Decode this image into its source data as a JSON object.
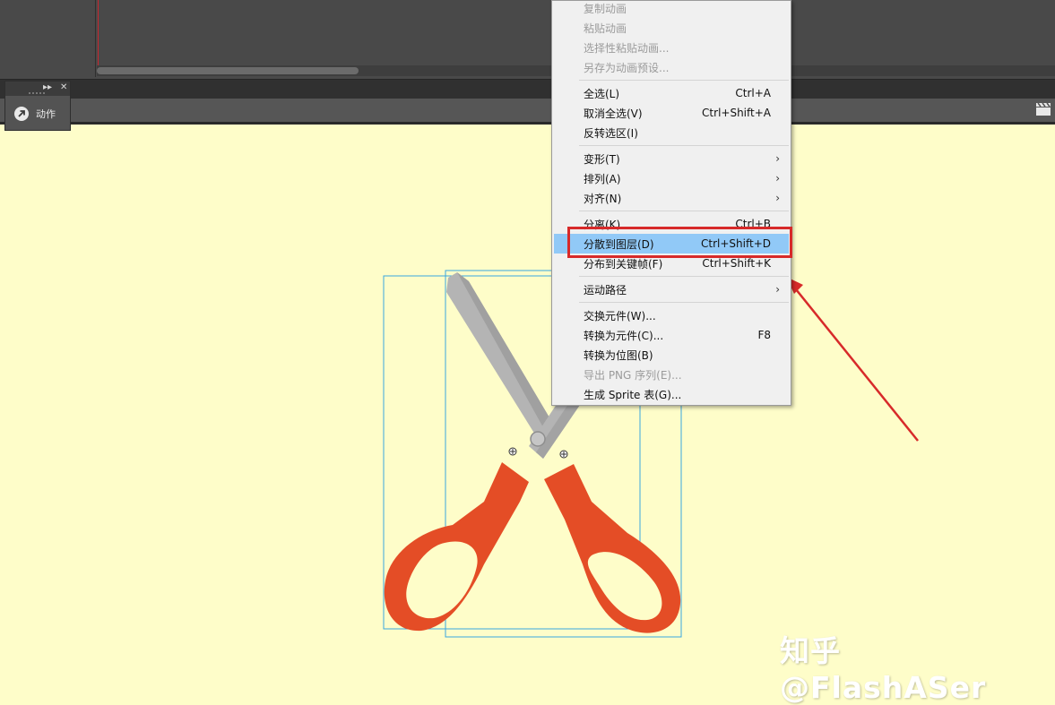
{
  "actions_panel": {
    "label": "动作",
    "expand_glyph": "▸▸",
    "close_glyph": "✕"
  },
  "context_menu": {
    "items": [
      {
        "label": "复制动画",
        "shortcut": "",
        "disabled": true
      },
      {
        "label": "粘贴动画",
        "shortcut": "",
        "disabled": true
      },
      {
        "label": "选择性粘贴动画...",
        "shortcut": "",
        "disabled": true
      },
      {
        "label": "另存为动画预设...",
        "shortcut": "",
        "disabled": true
      },
      {
        "label": "全选(L)",
        "shortcut": "Ctrl+A",
        "disabled": false
      },
      {
        "label": "取消全选(V)",
        "shortcut": "Ctrl+Shift+A",
        "disabled": false
      },
      {
        "label": "反转选区(I)",
        "shortcut": "",
        "disabled": false
      },
      {
        "label": "变形(T)",
        "shortcut": "",
        "disabled": false,
        "submenu": true
      },
      {
        "label": "排列(A)",
        "shortcut": "",
        "disabled": false,
        "submenu": true
      },
      {
        "label": "对齐(N)",
        "shortcut": "",
        "disabled": false,
        "submenu": true
      },
      {
        "label": "分离(K)",
        "shortcut": "Ctrl+B",
        "disabled": false
      },
      {
        "label": "分散到图层(D)",
        "shortcut": "Ctrl+Shift+D",
        "disabled": false,
        "highlighted": true
      },
      {
        "label": "分布到关键帧(F)",
        "shortcut": "Ctrl+Shift+K",
        "disabled": false
      },
      {
        "label": "运动路径",
        "shortcut": "",
        "disabled": false,
        "submenu": true
      },
      {
        "label": "交换元件(W)...",
        "shortcut": "",
        "disabled": false
      },
      {
        "label": "转换为元件(C)...",
        "shortcut": "F8",
        "disabled": false
      },
      {
        "label": "转换为位图(B)",
        "shortcut": "",
        "disabled": false
      },
      {
        "label": "导出 PNG 序列(E)...",
        "shortcut": "",
        "disabled": true
      },
      {
        "label": "生成 Sprite 表(G)...",
        "shortcut": "",
        "disabled": false
      }
    ],
    "submenu_glyph": "›"
  },
  "watermark": "知乎 @FlashASer",
  "colors": {
    "stage": "#fefdc9",
    "handle": "#e44d26",
    "blade": "#b4b4b4",
    "menu_highlight": "#91c9f7",
    "annotation_red": "#d72a2a",
    "selection_box": "#3aa6e0"
  }
}
